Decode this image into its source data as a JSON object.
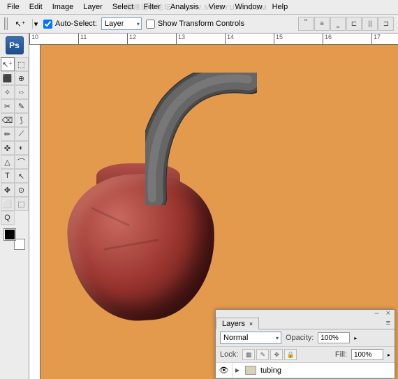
{
  "menu": [
    "File",
    "Edit",
    "Image",
    "Layer",
    "Select",
    "Filter",
    "Analysis",
    "View",
    "Window",
    "Help"
  ],
  "optbar": {
    "auto_select": "Auto-Select:",
    "mode": "Layer",
    "transform": "Show Transform Controls",
    "tool_glyph": "↖⁺"
  },
  "ruler_h": [
    "10",
    "",
    "11",
    "",
    "12",
    "",
    "13",
    "",
    "14",
    "",
    "15",
    "",
    "16",
    "",
    "17"
  ],
  "ps_logo": "Ps",
  "tools": [
    "↖⁺",
    "⬚",
    "⬛",
    "⊕",
    "✧",
    "⇔",
    "✂",
    "✎",
    "⌫",
    "⟆",
    "✏",
    "⟋",
    "✜",
    "◐",
    "△",
    "⌒",
    "T",
    "↖",
    "✥",
    "⊙",
    "⬜",
    "⬚",
    "Q"
  ],
  "layers": {
    "tab": "Layers",
    "close_glyph": "×",
    "blend_mode": "Normal",
    "opacity_label": "Opacity:",
    "opacity_val": "100%",
    "lock_label": "Lock:",
    "fill_label": "Fill:",
    "fill_val": "100%",
    "eye_glyph": "👁",
    "toggle_glyph": "▶",
    "layer_name": "tubing",
    "min_glyph": "–",
    "menu_glyph": "≡"
  },
  "watermark": "思缘设计论坛 · WWW.MISSYUAN.COM"
}
